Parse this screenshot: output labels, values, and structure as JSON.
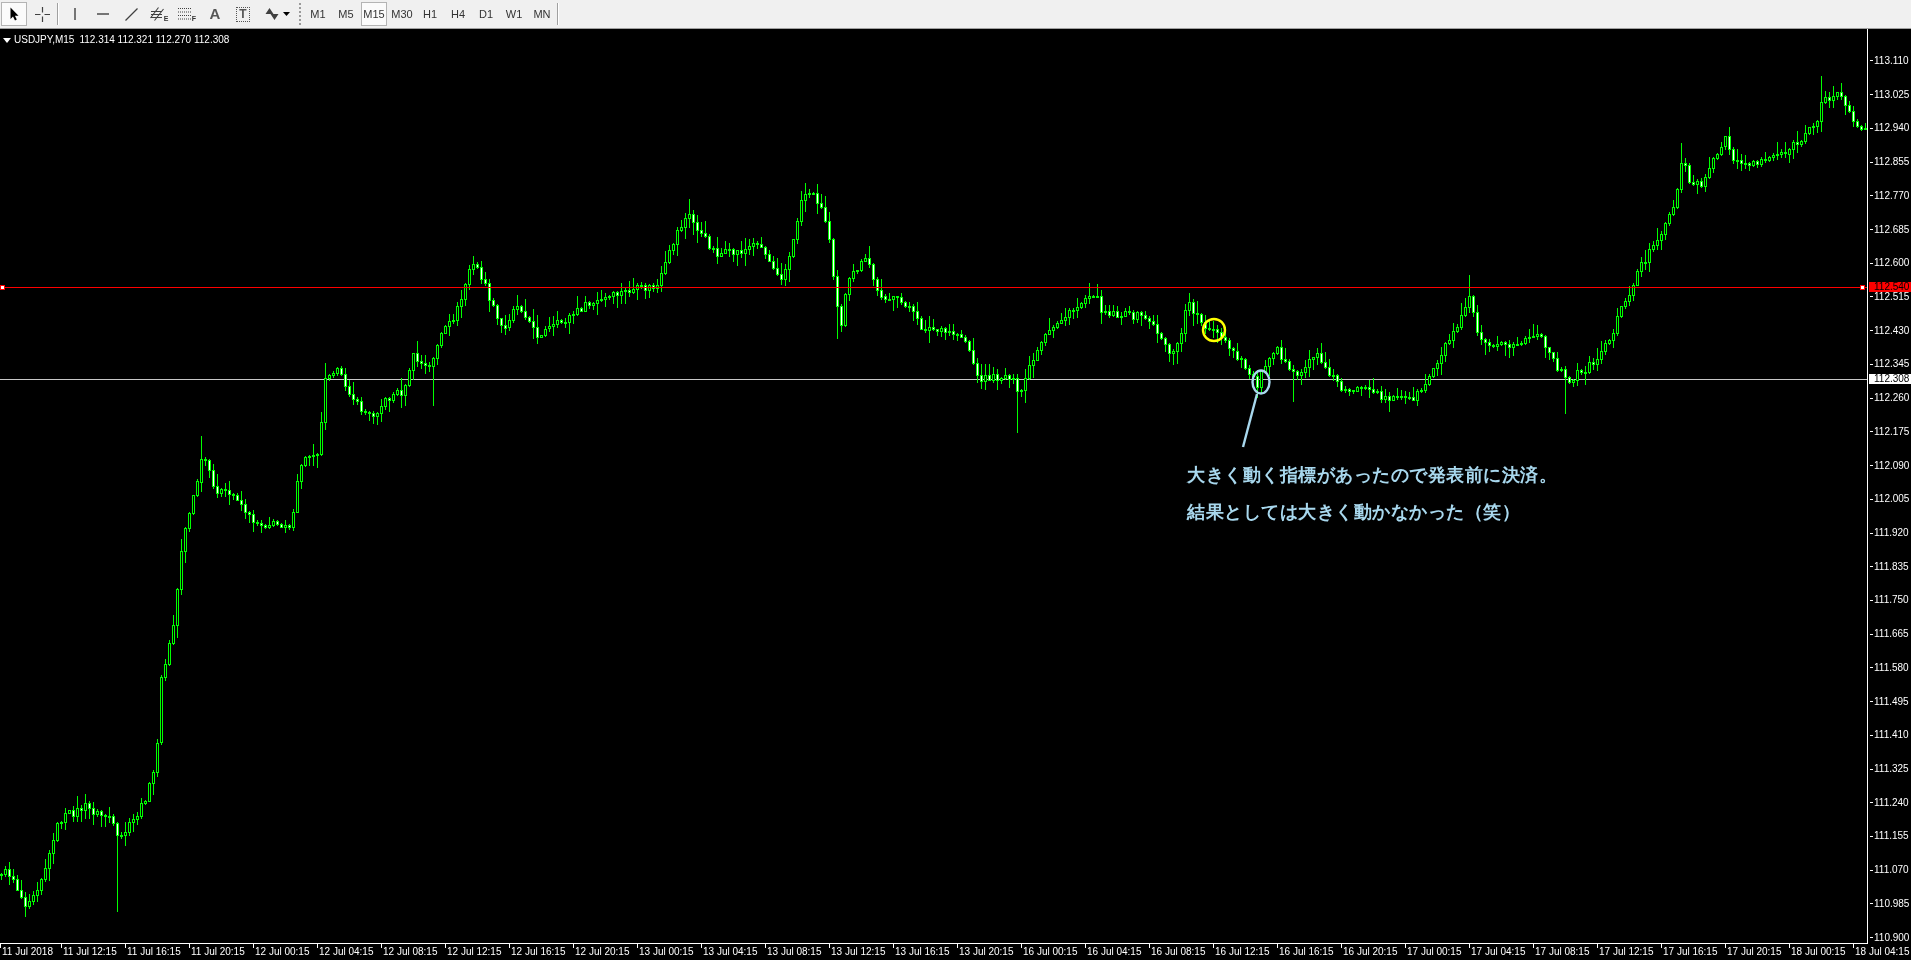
{
  "toolbar": {
    "tool_groups": [
      [
        {
          "kind": "cursor",
          "selected": true
        },
        {
          "kind": "crosshair",
          "selected": false
        }
      ],
      [
        {
          "kind": "vertical-line",
          "selected": false
        },
        {
          "kind": "horizontal-line",
          "selected": false
        },
        {
          "kind": "trendline",
          "selected": false
        },
        {
          "kind": "channel",
          "letter": "E",
          "selected": false
        },
        {
          "kind": "fibonacci",
          "letter": "F",
          "selected": false
        },
        {
          "kind": "text",
          "letter": "A",
          "selected": false
        },
        {
          "kind": "label",
          "letter": "T",
          "selected": false
        },
        {
          "kind": "arrows",
          "selected": false
        }
      ]
    ],
    "timeframes": [
      {
        "label": "M1",
        "selected": false
      },
      {
        "label": "M5",
        "selected": false
      },
      {
        "label": "M15",
        "selected": true
      },
      {
        "label": "M30",
        "selected": false
      },
      {
        "label": "H1",
        "selected": false
      },
      {
        "label": "H4",
        "selected": false
      },
      {
        "label": "D1",
        "selected": false
      },
      {
        "label": "W1",
        "selected": false
      },
      {
        "label": "MN",
        "selected": false
      }
    ]
  },
  "chart": {
    "symbol": "USDJPY,M15",
    "quote": "112.314 112.321 112.270 112.308",
    "horizontal_line": {
      "price_label": "112.540",
      "selected": true
    },
    "bid_line": {
      "price_label": "112.308"
    },
    "markers": [
      {
        "kind": "circle",
        "color": "#ffff00"
      },
      {
        "kind": "ellipse",
        "color": "#a8d8ee"
      }
    ],
    "notes": [
      "大きく動く指標があったので発表前に決済。",
      "結果としては大きく動かなかった（笑）"
    ],
    "price_axis": [
      "113.110",
      "113.025",
      "112.940",
      "112.855",
      "112.770",
      "112.685",
      "112.600",
      "112.515",
      "112.430",
      "112.345",
      "112.260",
      "112.175",
      "112.090",
      "112.005",
      "111.920",
      "111.835",
      "111.750",
      "111.665",
      "111.580",
      "111.495",
      "111.410",
      "111.325",
      "111.240",
      "111.155",
      "111.070",
      "110.985",
      "110.900"
    ],
    "time_axis": [
      "11 Jul 2018",
      "11 Jul 12:15",
      "11 Jul 16:15",
      "11 Jul 20:15",
      "12 Jul 00:15",
      "12 Jul 04:15",
      "12 Jul 08:15",
      "12 Jul 12:15",
      "12 Jul 16:15",
      "12 Jul 20:15",
      "13 Jul 00:15",
      "13 Jul 04:15",
      "13 Jul 08:15",
      "13 Jul 12:15",
      "13 Jul 16:15",
      "13 Jul 20:15",
      "16 Jul 00:15",
      "16 Jul 04:15",
      "16 Jul 08:15",
      "16 Jul 12:15",
      "16 Jul 16:15",
      "16 Jul 20:15",
      "17 Jul 00:15",
      "17 Jul 04:15",
      "17 Jul 08:15",
      "17 Jul 12:15",
      "17 Jul 16:15",
      "17 Jul 20:15",
      "18 Jul 00:15",
      "18 Jul 04:15"
    ]
  }
}
